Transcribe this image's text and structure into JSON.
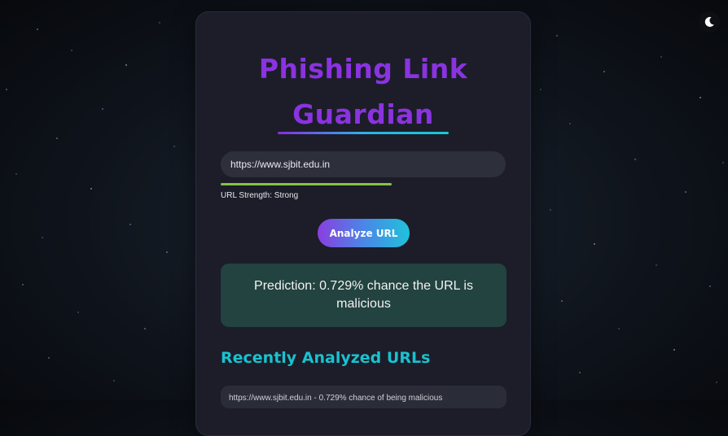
{
  "app": {
    "title": "Phishing Link Guardian"
  },
  "theme_toggle": {
    "icon": "moon-icon"
  },
  "url_input": {
    "value": "https://www.sjbit.edu.in",
    "strength_label": "URL Strength: Strong",
    "strength_fraction": 0.6,
    "strength_color": "#86c24a"
  },
  "analyze_button": {
    "label": "Analyze URL"
  },
  "result": {
    "text": "Prediction: 0.729% chance the URL is malicious",
    "background": "#22433f"
  },
  "recent": {
    "heading": "Recently Analyzed URLs",
    "items": [
      {
        "text": "https://www.sjbit.edu.in - 0.729% chance of being malicious"
      }
    ]
  },
  "colors": {
    "title": "#8a33e0",
    "accent_teal": "#19c2cf",
    "card_bg": "#1c1d29"
  }
}
